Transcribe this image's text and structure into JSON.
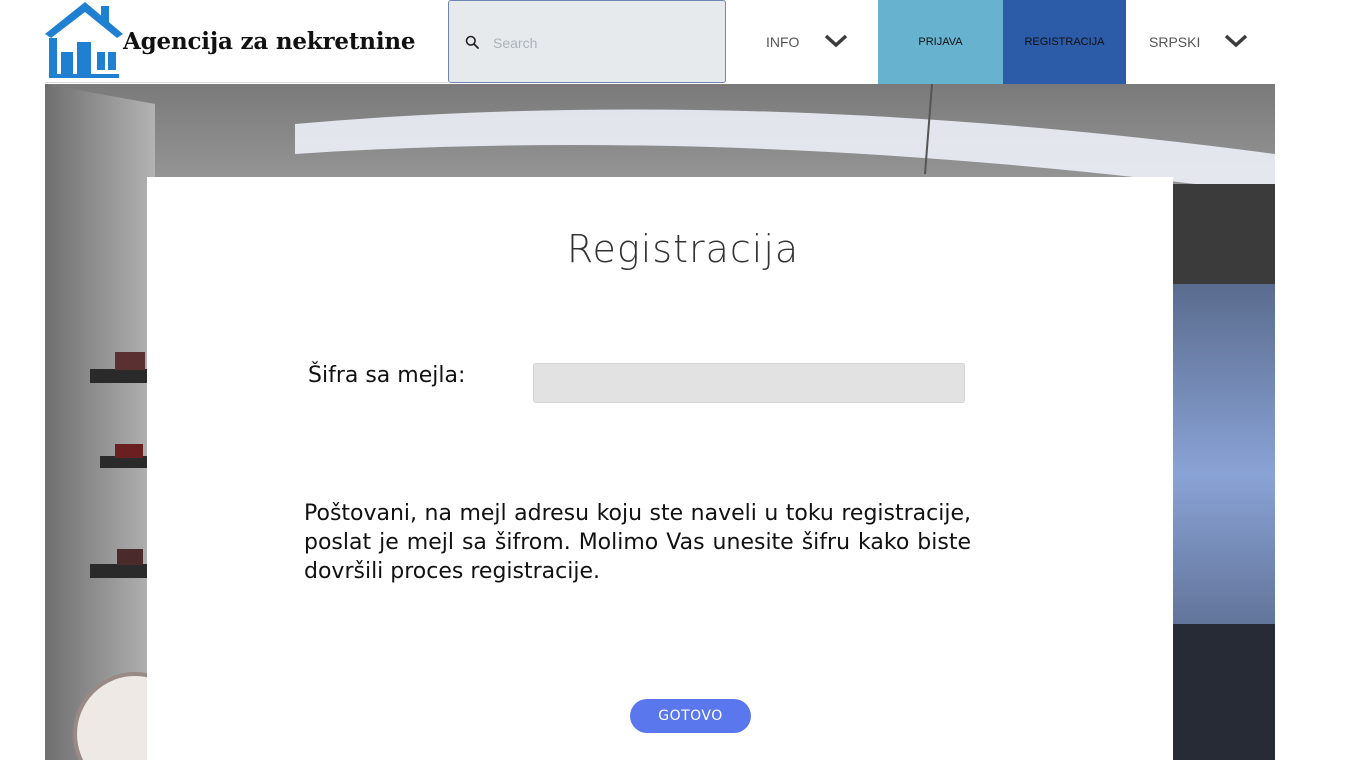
{
  "header": {
    "logo_text": "Agencija za nekretnine",
    "search": {
      "placeholder": "Search",
      "value": ""
    },
    "nav": {
      "info_label": "INFO",
      "login_label": "PRIJAVA",
      "register_label": "REGISTRACIJA",
      "language_label": "SRPSKI"
    }
  },
  "form": {
    "title": "Registracija",
    "code_label": "Šifra sa mejla:",
    "code_value": "",
    "message": "Poštovani, na mejl adresu koju ste naveli u toku registracije, poslat je mejl sa šifrom. Molimo Vas unesite šifru kako biste dovršili proces registracije.",
    "submit_label": "GOTOVO"
  },
  "colors": {
    "login_button": "#66b2cf",
    "register_button": "#2c5ba7",
    "submit_button": "#5b77ee",
    "logo_blue": "#1f7fd0"
  },
  "icons": {
    "search": "search-icon",
    "info_dropdown": "chevron-down-icon",
    "language_dropdown": "chevron-down-icon",
    "logo": "house-logo-icon"
  }
}
